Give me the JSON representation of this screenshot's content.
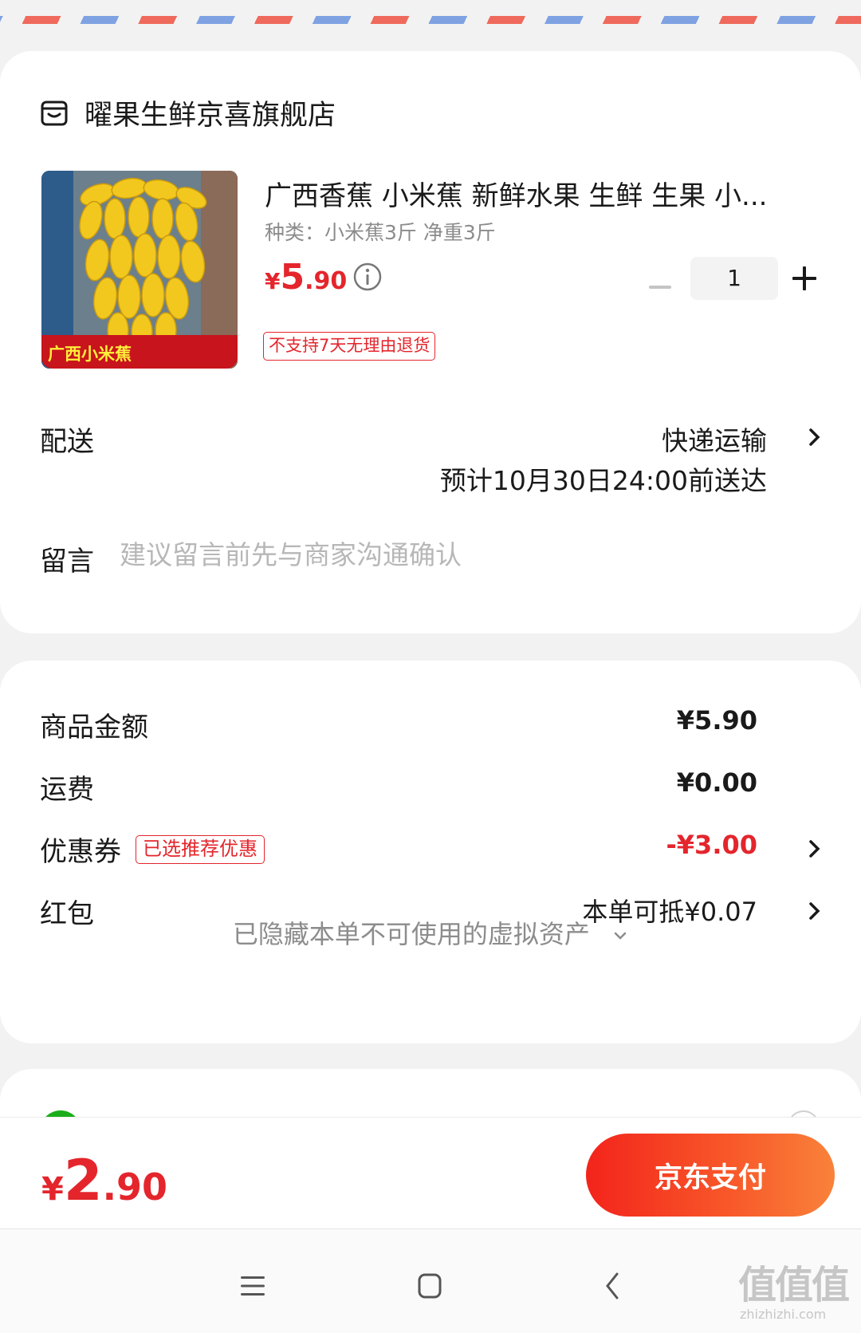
{
  "shop": {
    "name": "曜果生鲜京喜旗舰店",
    "icon": "store-icon"
  },
  "product": {
    "title": "广西香蕉 小米蕉   新鲜水果 生鲜 生果 小...",
    "spec": "种类：小米蕉3斤 净重3斤",
    "image_caption": "广西小米蕉",
    "price_yen": "¥",
    "price_int": "5",
    "price_dec": ".90",
    "return_policy": "不支持7天无理由退货",
    "quantity": "1"
  },
  "delivery": {
    "label": "配送",
    "method": "快递运输",
    "eta": "预计10月30日24:00前送达"
  },
  "note": {
    "label": "留言",
    "placeholder": "建议留言前先与商家沟通确认"
  },
  "summary": {
    "goods_label": "商品金额",
    "goods_value": "¥5.90",
    "shipping_label": "运费",
    "shipping_value": "¥0.00",
    "coupon_label": "优惠券",
    "coupon_badge": "已选推荐优惠",
    "coupon_value": "-¥3.00",
    "redpacket_label": "红包",
    "redpacket_value": "本单可抵¥0.07",
    "hidden_assets": "已隐藏本单不可使用的虚拟资产"
  },
  "footer": {
    "total_yen": "¥",
    "total_int": "2",
    "total_dec": ".90",
    "pay_button": "京东支付"
  },
  "watermark": {
    "mark": "值值值",
    "site": "zhizhizhi.com"
  },
  "colors": {
    "accent_red": "#e4252c",
    "pay_gradient_start": "#f3241b",
    "pay_gradient_end": "#f9823a",
    "airmail_red": "#ef6a5c",
    "airmail_blue": "#7ea2e2",
    "wechat_green": "#1aad19"
  }
}
